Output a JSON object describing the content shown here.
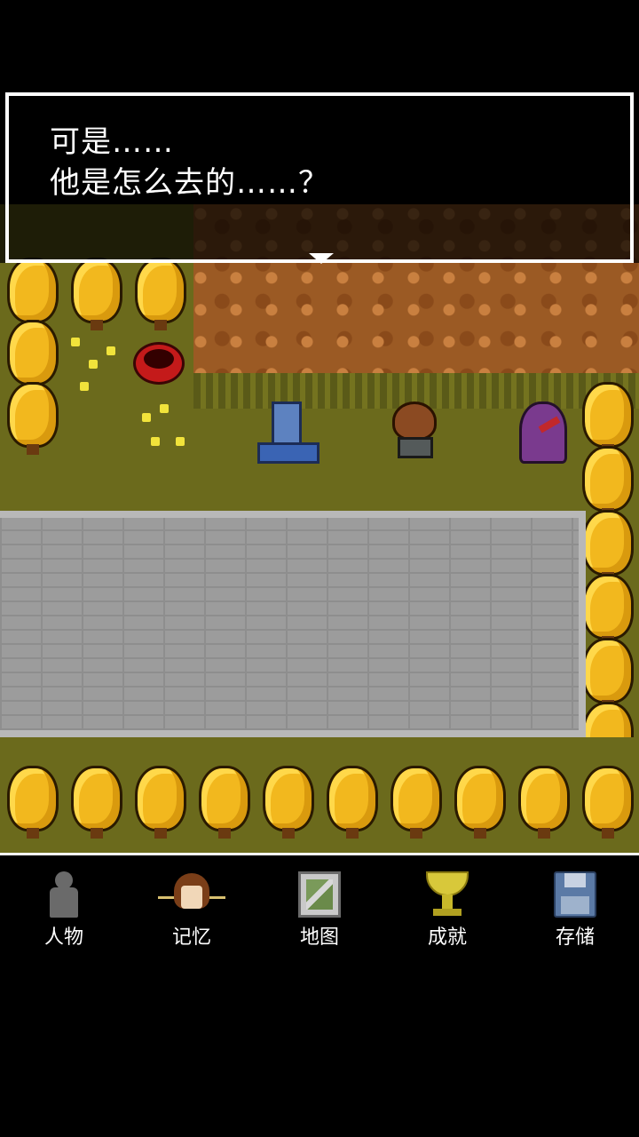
{
  "dialog": {
    "line1": "可是……",
    "line2": "他是怎么去的……？"
  },
  "menu": {
    "items": [
      {
        "label": "人物",
        "icon": "person-icon"
      },
      {
        "label": "记忆",
        "icon": "memory-portrait-icon"
      },
      {
        "label": "地图",
        "icon": "map-icon"
      },
      {
        "label": "成就",
        "icon": "trophy-icon"
      },
      {
        "label": "存储",
        "icon": "save-disk-icon"
      }
    ]
  }
}
